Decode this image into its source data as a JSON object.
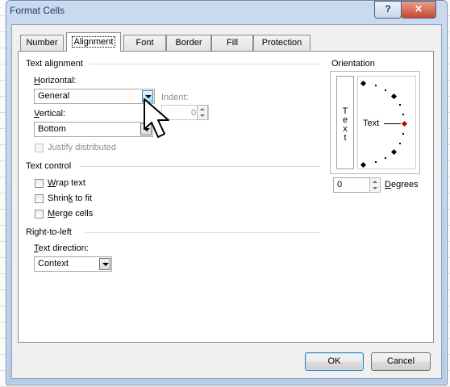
{
  "window": {
    "title": "Format Cells",
    "help_glyph": "?",
    "close_glyph": "✕"
  },
  "tabs": [
    {
      "label": "Number",
      "active": false
    },
    {
      "label": "Alignment",
      "active": true
    },
    {
      "label": "Font",
      "active": false
    },
    {
      "label": "Border",
      "active": false
    },
    {
      "label": "Fill",
      "active": false
    },
    {
      "label": "Protection",
      "active": false
    }
  ],
  "text_alignment": {
    "heading": "Text alignment",
    "horizontal_label_key": "H",
    "horizontal_label_rest": "orizontal:",
    "horizontal_value": "General",
    "indent_label": "Indent:",
    "indent_value": "0",
    "vertical_label_key": "V",
    "vertical_label_rest": "ertical:",
    "vertical_value": "Bottom",
    "justify_distributed": "Justify distributed"
  },
  "text_control": {
    "heading": "Text control",
    "wrap_key": "W",
    "wrap_rest": "rap text",
    "shrink_pre": "Shrin",
    "shrink_key": "k",
    "shrink_post": " to fit",
    "merge_key": "M",
    "merge_rest": "erge cells"
  },
  "rtl": {
    "heading": "Right-to-left",
    "direction_label_key": "T",
    "direction_label_rest": "ext direction:",
    "direction_value": "Context"
  },
  "orientation": {
    "heading": "Orientation",
    "vertical_text": [
      "T",
      "e",
      "x",
      "t"
    ],
    "dial_text": "Text",
    "degrees_value": "0",
    "degrees_key": "D",
    "degrees_rest": "egrees"
  },
  "buttons": {
    "ok": "OK",
    "cancel": "Cancel"
  },
  "colors": {
    "accent": "#3c7fb1",
    "dial_marker": "#c00000",
    "panel_bg": "#ffffff",
    "title_bar": "#c9daf0"
  }
}
